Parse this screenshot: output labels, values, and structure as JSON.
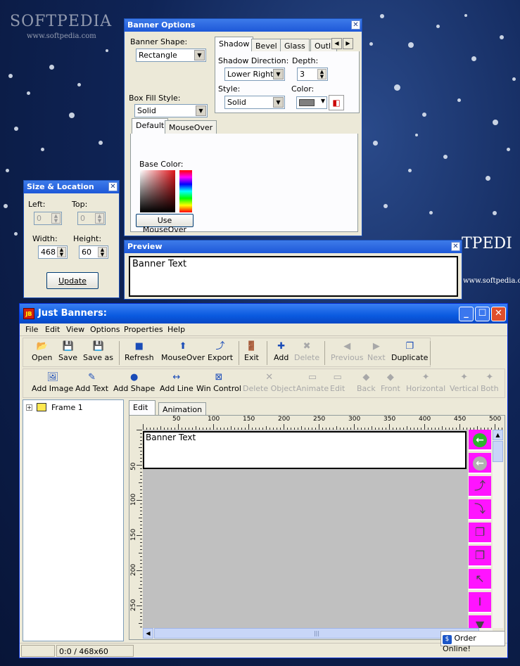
{
  "watermark": {
    "logo": "SOFTPEDIA",
    "url": "www.softpedia.com",
    "right_logo": "TPEDI",
    "right_url": "www.softpedia.com"
  },
  "banner_options": {
    "title": "Banner Options",
    "shape_label": "Banner Shape:",
    "shape_value": "Rectangle",
    "fill_label": "Box Fill Style:",
    "fill_value": "Solid",
    "tabs": [
      "Shadow",
      "Bevel",
      "Glass",
      "Outlin"
    ],
    "shadow_direction_label": "Shadow Direction:",
    "shadow_direction_value": "Lower Right",
    "depth_label": "Depth:",
    "depth_value": "3",
    "style_label": "Style:",
    "style_value": "Solid",
    "color_label": "Color:",
    "shadow_color": "#808080",
    "fill_tabs": [
      "Default",
      "MouseOver"
    ],
    "base_color_label": "Base Color:",
    "use_mouseover_label": "Use MouseOver"
  },
  "size_location": {
    "title": "Size & Location",
    "left_label": "Left:",
    "left_value": "0",
    "top_label": "Top:",
    "top_value": "0",
    "width_label": "Width:",
    "width_value": "468",
    "height_label": "Height:",
    "height_value": "60",
    "update_label": "Update"
  },
  "preview": {
    "title": "Preview",
    "text": "Banner Text"
  },
  "main": {
    "title": "Just Banners:",
    "app_icon": "JB",
    "menu": [
      "File",
      "Edit",
      "View",
      "Options",
      "Properties",
      "Help"
    ],
    "toolbar1": [
      {
        "label": "Open",
        "icon": "📂",
        "enabled": true
      },
      {
        "label": "Save",
        "icon": "💾",
        "enabled": true
      },
      {
        "label": "Save as",
        "icon": "💾",
        "enabled": true
      },
      {
        "label": "Refresh",
        "icon": "■",
        "enabled": true
      },
      {
        "label": "MouseOver",
        "icon": "⬆",
        "enabled": true
      },
      {
        "label": "Export",
        "icon": "⤴",
        "enabled": true
      },
      {
        "label": "Exit",
        "icon": "🚪",
        "enabled": true
      },
      {
        "label": "Add",
        "icon": "✚",
        "enabled": true
      },
      {
        "label": "Delete",
        "icon": "✖",
        "enabled": false
      },
      {
        "label": "Previous",
        "icon": "◀",
        "enabled": false
      },
      {
        "label": "Next",
        "icon": "▶",
        "enabled": false
      },
      {
        "label": "Duplicate",
        "icon": "❐",
        "enabled": true
      }
    ],
    "toolbar2": [
      {
        "label": "Add Image",
        "icon": "🖼",
        "enabled": true
      },
      {
        "label": "Add Text",
        "icon": "✎",
        "enabled": true
      },
      {
        "label": "Add Shape",
        "icon": "●",
        "enabled": true
      },
      {
        "label": "Add Line",
        "icon": "↔",
        "enabled": true
      },
      {
        "label": "Win Control",
        "icon": "⊠",
        "enabled": true
      },
      {
        "label": "Delete Object",
        "icon": "✕",
        "enabled": false
      },
      {
        "label": "Animate",
        "icon": "▭",
        "enabled": false
      },
      {
        "label": "Edit",
        "icon": "▭",
        "enabled": false
      },
      {
        "label": "Back",
        "icon": "◆",
        "enabled": false
      },
      {
        "label": "Front",
        "icon": "◆",
        "enabled": false
      },
      {
        "label": "Horizontal",
        "icon": "✦",
        "enabled": false
      },
      {
        "label": "Vertical",
        "icon": "✦",
        "enabled": false
      },
      {
        "label": "Both",
        "icon": "✦",
        "enabled": false
      }
    ],
    "tree_item": "Frame 1",
    "edit_tabs": [
      "Edit",
      "Animation"
    ],
    "ruler_h": [
      "50",
      "100",
      "150",
      "200",
      "250",
      "300",
      "350",
      "400",
      "450",
      "500"
    ],
    "ruler_v": [
      "50",
      "100",
      "150",
      "200",
      "250"
    ],
    "canvas_text": "Banner Text",
    "status": "0:0 / 468x60",
    "order_label": "Order Online!"
  }
}
